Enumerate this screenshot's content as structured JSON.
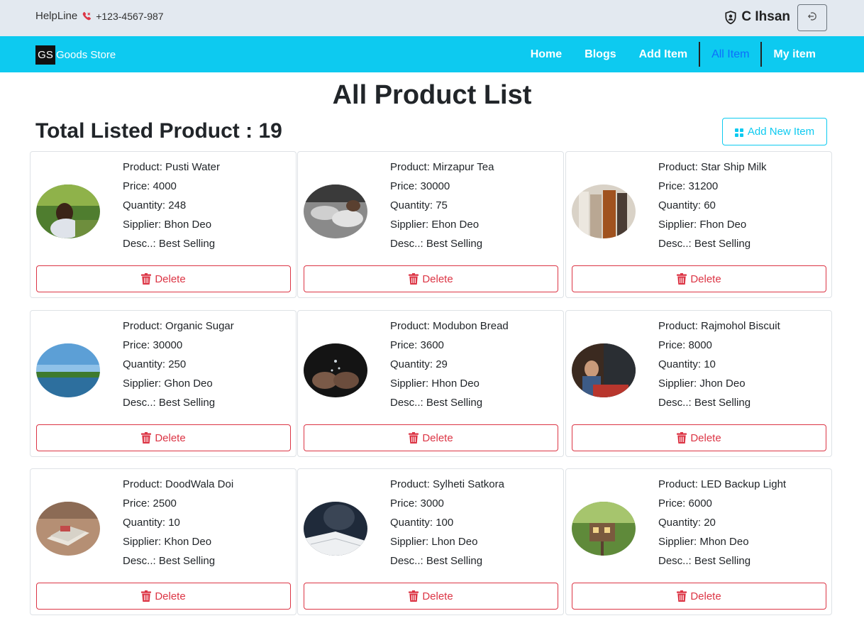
{
  "header": {
    "helpline_label": "HelpLine",
    "helpline_number": "+123-4567-987",
    "user_name": "C Ihsan"
  },
  "navbar": {
    "logo": "GS",
    "brand": "Goods Store",
    "links": [
      {
        "label": "Home",
        "active": false
      },
      {
        "label": "Blogs",
        "active": false
      },
      {
        "label": "Add Item",
        "active": false
      },
      {
        "label": "All Item",
        "active": true
      },
      {
        "label": "My item",
        "active": false
      }
    ]
  },
  "main": {
    "title": "All Product List",
    "total": "Total Listed Product : 19",
    "add_new_label": "Add New Item",
    "delete_label": "Delete",
    "colors": {
      "accent": "#0dcaf0",
      "danger": "#dc3545",
      "active": "#0d6efd"
    },
    "products": [
      {
        "product": "Product: Pusti Water",
        "price": "Price: 4000",
        "quantity": "Quantity: 248",
        "supplier": "Sipplier: Bhon Deo",
        "desc": "Desc..: Best Selling"
      },
      {
        "product": "Product: Mirzapur Tea",
        "price": "Price: 30000",
        "quantity": "Quantity: 75",
        "supplier": "Sipplier: Ehon Deo",
        "desc": "Desc..: Best Selling"
      },
      {
        "product": "Product: Star Ship Milk",
        "price": "Price: 31200",
        "quantity": "Quantity: 60",
        "supplier": "Sipplier: Fhon Deo",
        "desc": "Desc..: Best Selling"
      },
      {
        "product": "Product: Organic Sugar",
        "price": "Price: 30000",
        "quantity": "Quantity: 250",
        "supplier": "Sipplier: Ghon Deo",
        "desc": "Desc..: Best Selling"
      },
      {
        "product": "Product: Modubon Bread",
        "price": "Price: 3600",
        "quantity": "Quantity: 29",
        "supplier": "Sipplier: Hhon Deo",
        "desc": "Desc..: Best Selling"
      },
      {
        "product": "Product: Rajmohol Biscuit",
        "price": "Price: 8000",
        "quantity": "Quantity: 10",
        "supplier": "Sipplier: Jhon Deo",
        "desc": "Desc..: Best Selling"
      },
      {
        "product": "Product: DoodWala Doi",
        "price": "Price: 2500",
        "quantity": "Quantity: 10",
        "supplier": "Sipplier: Khon Deo",
        "desc": "Desc..: Best Selling"
      },
      {
        "product": "Product: Sylheti Satkora",
        "price": "Price: 3000",
        "quantity": "Quantity: 100",
        "supplier": "Sipplier: Lhon Deo",
        "desc": "Desc..: Best Selling"
      },
      {
        "product": "Product: LED Backup Light",
        "price": "Price: 6000",
        "quantity": "Quantity: 20",
        "supplier": "Sipplier: Mhon Deo",
        "desc": "Desc..: Best Selling"
      }
    ]
  }
}
